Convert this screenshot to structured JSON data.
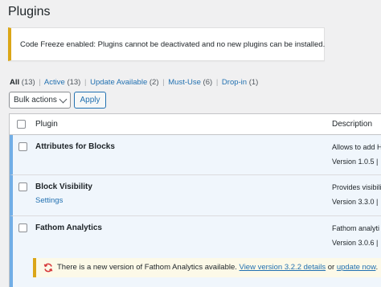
{
  "page": {
    "title": "Plugins"
  },
  "notice": {
    "text": "Code Freeze enabled: Plugins cannot be deactivated and no new plugins can be installed."
  },
  "filters": [
    {
      "label": "All",
      "count": "(13)"
    },
    {
      "label": "Active",
      "count": "(13)"
    },
    {
      "label": "Update Available",
      "count": "(2)"
    },
    {
      "label": "Must-Use",
      "count": "(6)"
    },
    {
      "label": "Drop-in",
      "count": "(1)"
    }
  ],
  "bulk": {
    "selected": "Bulk actions",
    "apply_label": "Apply"
  },
  "table": {
    "columns": {
      "plugin": "Plugin",
      "description": "Description"
    },
    "rows": [
      {
        "name": "Attributes for Blocks",
        "link": "",
        "description": "Allows to add H",
        "version": "Version 1.0.5 |"
      },
      {
        "name": "Block Visibility",
        "link": "Settings",
        "description": "Provides visibili",
        "version": "Version 3.3.0 |"
      },
      {
        "name": "Fathom Analytics",
        "link": "",
        "description": "Fathom analyti",
        "version": "Version 3.0.6 |"
      }
    ]
  },
  "update_notice": {
    "prefix": "There is a new version of Fathom Analytics available.",
    "details_link": "View version 3.2.2 details",
    "or": "or",
    "update_link": "update now",
    "suffix": "."
  },
  "colors": {
    "accent": "#2271b1",
    "warning": "#dba617",
    "update_icon": "#d63638"
  }
}
